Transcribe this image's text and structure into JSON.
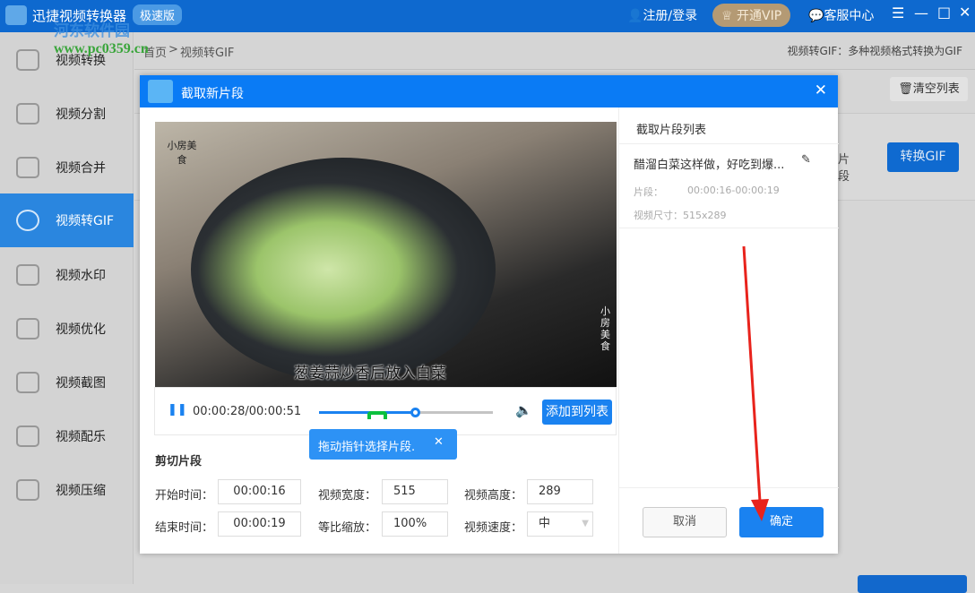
{
  "app": {
    "title": "迅捷视频转换器",
    "edition": "极速版",
    "login": "注册/登录",
    "vip": "开通VIP",
    "service": "客服中心"
  },
  "watermark": {
    "name": "河东软件园",
    "url": "www.pc0359.cn"
  },
  "sidebar": {
    "items": [
      {
        "label": "视频转换"
      },
      {
        "label": "视频分割"
      },
      {
        "label": "视频合并"
      },
      {
        "label": "视频转GIF",
        "active": true
      },
      {
        "label": "视频水印"
      },
      {
        "label": "视频优化"
      },
      {
        "label": "视频截图"
      },
      {
        "label": "视频配乐"
      },
      {
        "label": "视频压缩"
      }
    ]
  },
  "breadcrumb": {
    "home": "首页",
    "sep": ">",
    "current": "视频转GIF",
    "description": "视频转GIF：多种视频格式转换为GIF"
  },
  "main": {
    "clear_list": "清空列表",
    "convert": "转换GIF",
    "partial": "片段"
  },
  "dialog": {
    "title": "截取新片段",
    "video": {
      "subtitle": "葱姜蒜炒香后放入白菜",
      "logo": "小房美食",
      "logo_side": "小房美食"
    },
    "player": {
      "time": "00:00:28/00:00:51",
      "progress": 0.55,
      "add_to_list": "添加到列表"
    },
    "tooltip": "拖动指针选择片段.",
    "cut": {
      "heading": "剪切片段",
      "start_label": "开始时间：",
      "start": "00:00:16",
      "end_label": "结束时间：",
      "end": "00:00:19",
      "width_label": "视频宽度：",
      "width": "515",
      "scale_label": "等比缩放：",
      "scale": "100%",
      "height_label": "视频高度：",
      "height": "289",
      "speed_label": "视频速度：",
      "speed": "中"
    },
    "list": {
      "heading": "截取片段列表",
      "items": [
        {
          "name": "醋溜白菜这样做，好吃到爆...",
          "segment_label": "片段：",
          "segment": "00:00:16-00:00:19",
          "size": "视频尺寸：515x289"
        }
      ]
    },
    "cancel": "取消",
    "confirm": "确定"
  },
  "colors": {
    "titlebar": "#0e69cf",
    "dialog_header": "#0a7bf5",
    "accent": "#1a82f0",
    "arrow": "#e8231c"
  }
}
